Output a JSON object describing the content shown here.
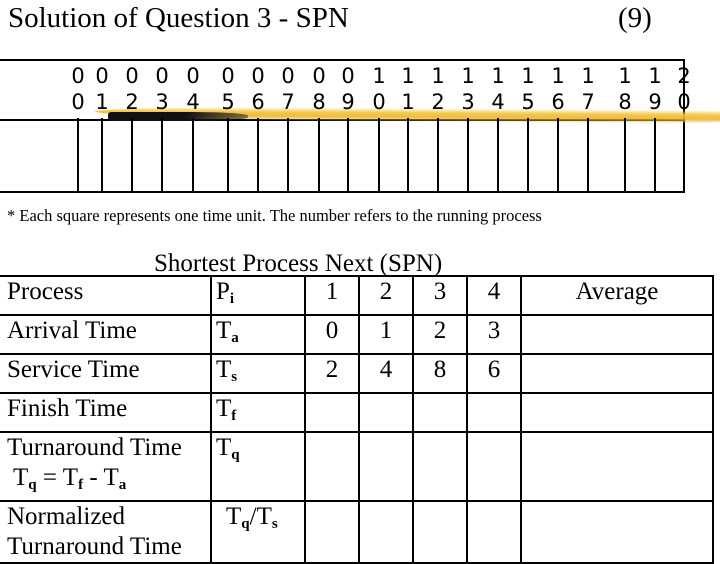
{
  "slide": {
    "title": "Solution of Question 3 - SPN",
    "number": "(9)"
  },
  "timeline": {
    "tens_digits": [
      "0",
      "0",
      "0",
      "0",
      "0",
      "0",
      "0",
      "0",
      "0",
      "0",
      "1",
      "1",
      "1",
      "1",
      "1",
      "1",
      "1",
      "1",
      "1",
      "1",
      "2"
    ],
    "ones_digits": [
      "0",
      "1",
      "2",
      "3",
      "4",
      "5",
      "6",
      "7",
      "8",
      "9",
      "0",
      "1",
      "2",
      "3",
      "4",
      "5",
      "6",
      "7",
      "8",
      "9",
      "0"
    ],
    "time_units": 20,
    "cells": [
      "",
      "",
      "",
      "",
      "",
      "",
      "",
      "",
      "",
      "",
      "",
      "",
      "",
      "",
      "",
      "",
      "",
      "",
      "",
      ""
    ],
    "highlight_color": "#eab52a"
  },
  "note": "* Each square represents one time unit. The number refers to the running process",
  "table": {
    "caption": "Shortest Process Next (SPN)",
    "average_header": "Average",
    "rows": [
      {
        "label": "Process",
        "label2": "",
        "sym_base": "P",
        "sym_sub": "i",
        "sym_suffix_base": "",
        "sym_suffix_sub": "",
        "values": [
          "1",
          "2",
          "3",
          "4"
        ],
        "average": ""
      },
      {
        "label": "Arrival Time",
        "label2": "",
        "sym_base": "T",
        "sym_sub": "a",
        "sym_suffix_base": "",
        "sym_suffix_sub": "",
        "values": [
          "0",
          "1",
          "2",
          "3"
        ],
        "average": ""
      },
      {
        "label": "Service Time",
        "label2": "",
        "sym_base": "T",
        "sym_sub": "s",
        "sym_suffix_base": "",
        "sym_suffix_sub": "",
        "values": [
          "2",
          "4",
          "8",
          "6"
        ],
        "average": ""
      },
      {
        "label": "Finish Time",
        "label2": "",
        "sym_base": "T",
        "sym_sub": "f",
        "sym_suffix_base": "",
        "sym_suffix_sub": "",
        "values": [
          "",
          "",
          "",
          ""
        ],
        "average": ""
      },
      {
        "label": "Turnaround Time",
        "label2": "",
        "sym_base": "T",
        "sym_sub": "q",
        "sym_suffix_base": "",
        "sym_suffix_sub": "",
        "values": [
          "",
          "",
          "",
          ""
        ],
        "average": ""
      },
      {
        "label": "Normalized",
        "label2": "Turnaround Time",
        "sym_base": "T",
        "sym_sub": "q",
        "sym_suffix_base": "/T",
        "sym_suffix_sub": "s",
        "values": [
          "",
          "",
          "",
          ""
        ],
        "average": ""
      }
    ],
    "formula": {
      "lhs_base": "T",
      "lhs_sub": "q",
      "eq": " = ",
      "a_base": "T",
      "a_sub": "f",
      "minus": " - ",
      "b_base": "T",
      "b_sub": "a"
    }
  }
}
